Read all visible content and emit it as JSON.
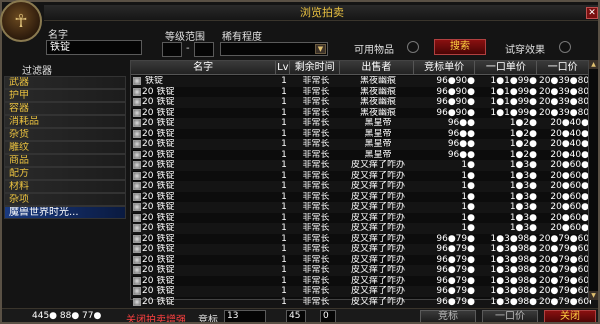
{
  "title": "浏览拍卖",
  "search": {
    "name_label": "名字",
    "name_value": "铁锭",
    "level_label": "等级范围",
    "level_separator": "-",
    "rarity_label": "稀有程度",
    "usable_label": "可用物品",
    "search_button": "搜索",
    "wearable_label": "试穿效果"
  },
  "filters": {
    "label": "过滤器",
    "items": [
      "武器",
      "护甲",
      "容器",
      "消耗品",
      "杂货",
      "雕纹",
      "商品",
      "配方",
      "材料",
      "杂项",
      "魔兽世界时光..."
    ],
    "selected_index": 10
  },
  "table": {
    "headers": [
      "名字",
      "Lv",
      "剩余时间",
      "出售者",
      "竞标单价",
      "一口单价",
      "一口价"
    ],
    "rows": [
      {
        "name": "铁锭",
        "qty": "",
        "lv": "1",
        "time": "非常长",
        "seller": "黑夜幽痕",
        "bid": "96●90●",
        "bo": "1●1●99●",
        "unit": "20●39●80●"
      },
      {
        "name": "铁锭",
        "qty": "20",
        "lv": "1",
        "time": "非常长",
        "seller": "黑夜幽痕",
        "bid": "96●90●",
        "bo": "1●1●99●",
        "unit": "20●39●80●"
      },
      {
        "name": "铁锭",
        "qty": "20",
        "lv": "1",
        "time": "非常长",
        "seller": "黑夜幽痕",
        "bid": "96●90●",
        "bo": "1●1●99●",
        "unit": "20●39●80●"
      },
      {
        "name": "铁锭",
        "qty": "20",
        "lv": "1",
        "time": "非常长",
        "seller": "黑夜幽痕",
        "bid": "96●90●",
        "bo": "1●1●99●",
        "unit": "20●39●80●"
      },
      {
        "name": "铁锭",
        "qty": "20",
        "lv": "1",
        "time": "非常长",
        "seller": "黑皇帝",
        "bid": "96●●",
        "bo": "1●2●",
        "unit": "20●40●"
      },
      {
        "name": "铁锭",
        "qty": "20",
        "lv": "1",
        "time": "非常长",
        "seller": "黑皇帝",
        "bid": "96●●",
        "bo": "1●2●",
        "unit": "20●40●"
      },
      {
        "name": "铁锭",
        "qty": "20",
        "lv": "1",
        "time": "非常长",
        "seller": "黑皇帝",
        "bid": "96●●",
        "bo": "1●2●",
        "unit": "20●40●"
      },
      {
        "name": "铁锭",
        "qty": "20",
        "lv": "1",
        "time": "非常长",
        "seller": "黑皇帝",
        "bid": "96●●",
        "bo": "1●2●",
        "unit": "20●40●"
      },
      {
        "name": "铁锭",
        "qty": "20",
        "lv": "1",
        "time": "非常长",
        "seller": "皮又痒了咋办",
        "bid": "1●",
        "bo": "1●3●",
        "unit": "20●60●"
      },
      {
        "name": "铁锭",
        "qty": "20",
        "lv": "1",
        "time": "非常长",
        "seller": "皮又痒了咋办",
        "bid": "1●",
        "bo": "1●3●",
        "unit": "20●60●"
      },
      {
        "name": "铁锭",
        "qty": "20",
        "lv": "1",
        "time": "非常长",
        "seller": "皮又痒了咋办",
        "bid": "1●",
        "bo": "1●3●",
        "unit": "20●60●"
      },
      {
        "name": "铁锭",
        "qty": "20",
        "lv": "1",
        "time": "非常长",
        "seller": "皮又痒了咋办",
        "bid": "1●",
        "bo": "1●3●",
        "unit": "20●60●"
      },
      {
        "name": "铁锭",
        "qty": "20",
        "lv": "1",
        "time": "非常长",
        "seller": "皮又痒了咋办",
        "bid": "1●",
        "bo": "1●3●",
        "unit": "20●60●"
      },
      {
        "name": "铁锭",
        "qty": "20",
        "lv": "1",
        "time": "非常长",
        "seller": "皮又痒了咋办",
        "bid": "1●",
        "bo": "1●3●",
        "unit": "20●60●"
      },
      {
        "name": "铁锭",
        "qty": "20",
        "lv": "1",
        "time": "非常长",
        "seller": "皮又痒了咋办",
        "bid": "1●",
        "bo": "1●3●",
        "unit": "20●60●"
      },
      {
        "name": "铁锭",
        "qty": "20",
        "lv": "1",
        "time": "非常长",
        "seller": "皮又痒了咋办",
        "bid": "96●79●",
        "bo": "1●3●98●",
        "unit": "20●79●60●"
      },
      {
        "name": "铁锭",
        "qty": "20",
        "lv": "1",
        "time": "非常长",
        "seller": "皮又痒了咋办",
        "bid": "96●79●",
        "bo": "1●3●98●",
        "unit": "20●79●60●"
      },
      {
        "name": "铁锭",
        "qty": "20",
        "lv": "1",
        "time": "非常长",
        "seller": "皮又痒了咋办",
        "bid": "96●79●",
        "bo": "1●3●98●",
        "unit": "20●79●60●"
      },
      {
        "name": "铁锭",
        "qty": "20",
        "lv": "1",
        "time": "非常长",
        "seller": "皮又痒了咋办",
        "bid": "96●79●",
        "bo": "1●3●98●",
        "unit": "20●79●60●"
      },
      {
        "name": "铁锭",
        "qty": "20",
        "lv": "1",
        "time": "非常长",
        "seller": "皮又痒了咋办",
        "bid": "96●79●",
        "bo": "1●3●98●",
        "unit": "20●79●60●"
      },
      {
        "name": "铁锭",
        "qty": "20",
        "lv": "1",
        "time": "非常长",
        "seller": "皮又痒了咋办",
        "bid": "96●79●",
        "bo": "1●3●98●",
        "unit": "20●79●60●"
      },
      {
        "name": "铁锭",
        "qty": "20",
        "lv": "1",
        "time": "非常长",
        "seller": "皮又痒了咋办",
        "bid": "96●79●",
        "bo": "1●3●98●",
        "unit": "20●79●60●"
      }
    ]
  },
  "bottom": {
    "money": "445● 88● 77●",
    "notice": "关闭拍卖增强",
    "bid_label": "竞标",
    "bid_gold": "13",
    "bid_silver": "45",
    "bid_copper": "0",
    "bid_button": "竞标",
    "buyout_button": "一口价",
    "close_button": "关闭"
  }
}
